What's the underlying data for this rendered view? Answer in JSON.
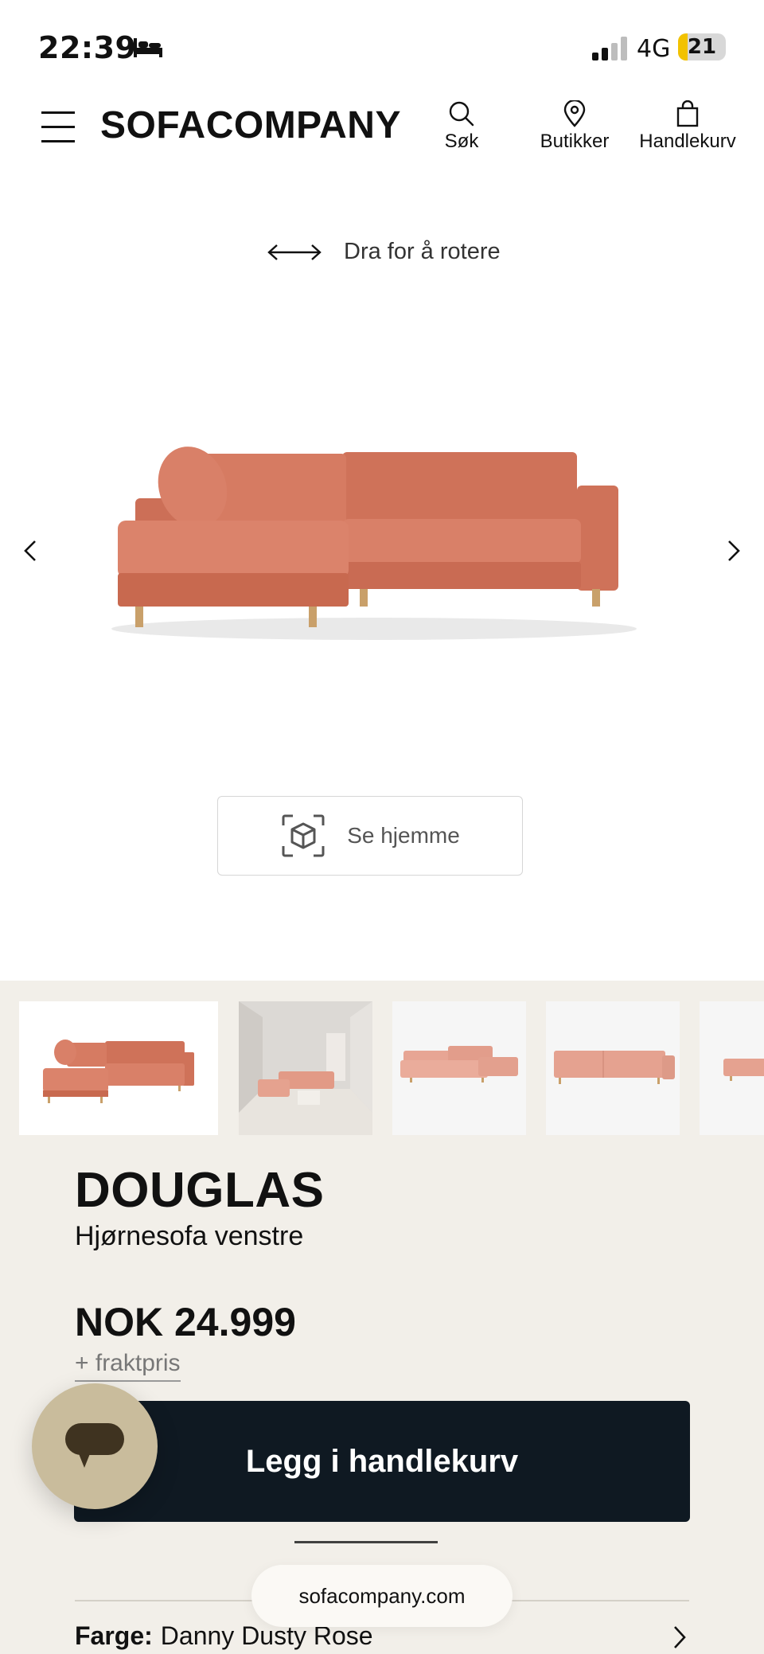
{
  "status_bar": {
    "time": "22:39",
    "network": "4G",
    "battery": "21"
  },
  "header": {
    "logo": "SOFACOMPANY",
    "nav": [
      {
        "label": "Søk",
        "icon": "search-icon"
      },
      {
        "label": "Butikker",
        "icon": "location-pin-icon"
      },
      {
        "label": "Handlekurv",
        "icon": "shopping-bag-icon"
      }
    ]
  },
  "viewer": {
    "rotate_hint": "Dra for å rotere",
    "ar_button": "Se hjemme"
  },
  "colors": {
    "sofa": "#d77a62",
    "sofa_dark": "#c2664f",
    "panel_bg": "#f2efe9",
    "button_dark": "#0f1922",
    "chat_bg": "#c9bc9c"
  },
  "product": {
    "name": "DOUGLAS",
    "subtitle": "Hjørnesofa venstre",
    "price": "NOK 24.999",
    "freight": "+ fraktpris",
    "add_to_cart": "Legg i handlekurv",
    "color_label": "Farge:",
    "color_value": "Danny Dusty Rose"
  },
  "browser": {
    "url": "sofacompany.com"
  }
}
